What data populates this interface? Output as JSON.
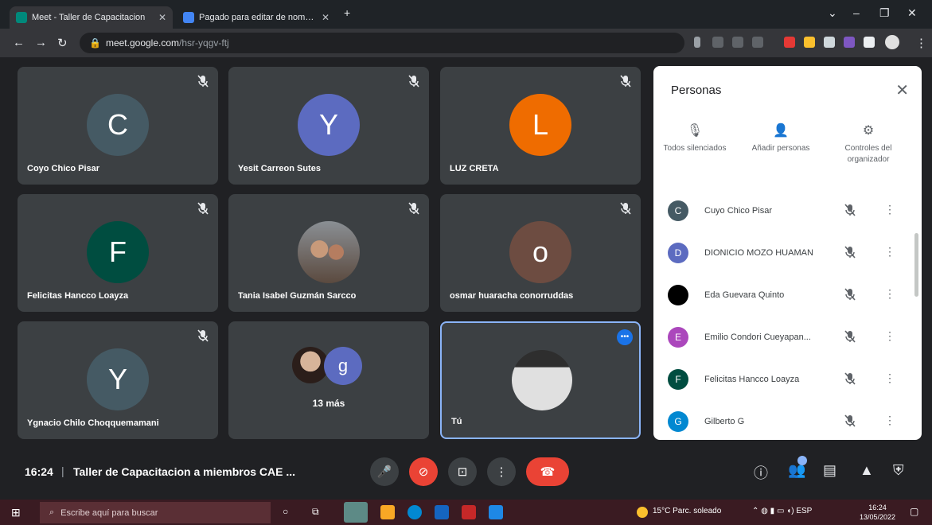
{
  "browser": {
    "tabs": [
      {
        "title": "Meet - Taller de Capacitacion",
        "active": true
      },
      {
        "title": "Pagado para editar de nombre",
        "active": false
      }
    ],
    "url_host": "meet.google.com",
    "url_path": "/hsr-yqgv-ftj"
  },
  "tiles": [
    {
      "name": "Coyo Chico Pisar",
      "initial": "C",
      "color": "#455a64"
    },
    {
      "name": "Yesit Carreon Sutes",
      "initial": "Y",
      "color": "#5c6bc0"
    },
    {
      "name": "LUZ CRETA",
      "initial": "L",
      "color": "#ef6c00"
    },
    {
      "name": "Felicitas Hancco Loayza",
      "initial": "F",
      "color": "#004d40"
    },
    {
      "name": "Tania Isabel Guzmán Sarcco",
      "initial": "",
      "color": "#7b6a5a"
    },
    {
      "name": "osmar huaracha conorruddas",
      "initial": "o",
      "color": "#6d4c41"
    },
    {
      "name": "Ygnacio Chilo Choqquemamani",
      "initial": "Y",
      "color": "#455a64"
    },
    {
      "name": "13 más",
      "initial": "g",
      "color": "#5c6bc0"
    },
    {
      "name": "Tú",
      "initial": "",
      "color": "#9e9e9e"
    }
  ],
  "panel": {
    "title": "Personas",
    "close": "✕",
    "actions": [
      {
        "label": "Todos silenciados",
        "icon": "🎙"
      },
      {
        "label": "Añadir personas",
        "icon": "👤"
      },
      {
        "label": "Controles del organizador",
        "icon": "⚙"
      }
    ],
    "people": [
      {
        "name": "Cuyo Chico Pisar",
        "initial": "C",
        "color": "#455a64"
      },
      {
        "name": "DIONICIO MOZO HUAMAN",
        "initial": "D",
        "color": "#5c6bc0"
      },
      {
        "name": "Eda Guevara Quinto",
        "initial": "",
        "color": "#000000"
      },
      {
        "name": "Emilio Condori Cueyapan...",
        "initial": "E",
        "color": "#ab47bc"
      },
      {
        "name": "Felicitas Hancco Loayza",
        "initial": "F",
        "color": "#004d40"
      },
      {
        "name": "Gilberto G",
        "initial": "G",
        "color": "#0288d1"
      }
    ]
  },
  "meeting": {
    "time": "16:24",
    "separator": "|",
    "title": "Taller de Capacitacion a miembros CAE ..."
  },
  "taskbar": {
    "search_placeholder": "Escribe aquí para buscar",
    "weather": "15°C Parc. soleado",
    "tray": "ESP",
    "clock_time": "16:24",
    "clock_date": "13/05/2022"
  }
}
